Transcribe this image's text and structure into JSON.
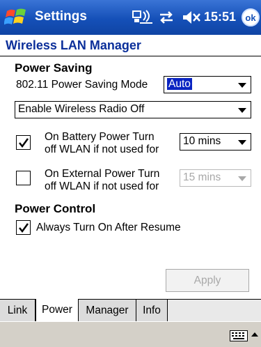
{
  "titlebar": {
    "app_title": "Settings",
    "time": "15:51",
    "ok_label": "ok"
  },
  "page": {
    "header": "Wireless LAN Manager"
  },
  "power_saving": {
    "title": "Power Saving",
    "mode_label": "802.11 Power Saving Mode",
    "mode_value": "Auto",
    "radio_value": "Enable Wireless Radio Off",
    "battery": {
      "checked": true,
      "line1": "On Battery Power Turn",
      "line2": "off WLAN if not used for",
      "value": "10 mins"
    },
    "external": {
      "checked": false,
      "line1": "On External Power Turn",
      "line2": "off WLAN if not used for",
      "value": "15 mins"
    }
  },
  "power_control": {
    "title": "Power Control",
    "resume_checked": true,
    "resume_label": "Always Turn On After Resume"
  },
  "apply_label": "Apply",
  "tabs": [
    {
      "label": "Link",
      "active": false
    },
    {
      "label": "Power",
      "active": true
    },
    {
      "label": "Manager",
      "active": false
    },
    {
      "label": "Info",
      "active": false
    }
  ],
  "colors": {
    "titlebar": "#1550b8",
    "header_text": "#0b2f9a",
    "selection": "#0a24c2"
  }
}
